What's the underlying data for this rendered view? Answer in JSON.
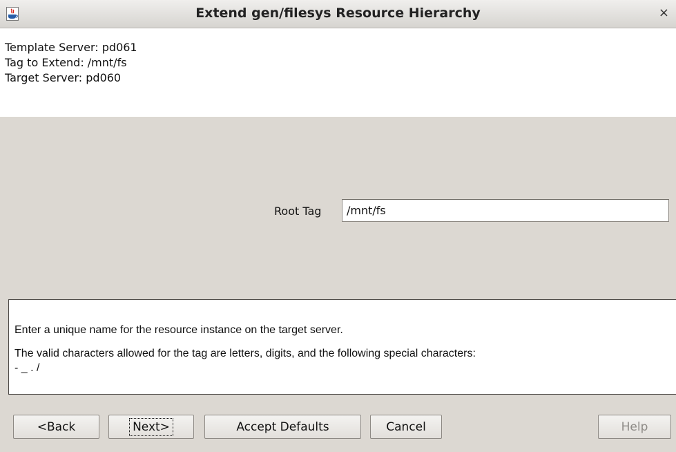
{
  "window": {
    "title": "Extend gen/filesys Resource Hierarchy",
    "close_glyph": "×"
  },
  "info": {
    "template_server": "Template Server: pd061",
    "tag_to_extend": "Tag to Extend: /mnt/fs",
    "target_server": "Target Server: pd060"
  },
  "form": {
    "root_tag_label": "Root Tag",
    "root_tag_value": "/mnt/fs"
  },
  "help": {
    "line1": "Enter a unique name for the resource instance on the target server.",
    "line2": "The valid characters allowed for the tag are letters, digits, and the following special characters:",
    "line3": "- _ . /"
  },
  "buttons": {
    "back": "<Back",
    "next": "Next>",
    "accept_defaults": "Accept Defaults",
    "cancel": "Cancel",
    "help": "Help"
  },
  "colors": {
    "dialog_bg": "#dcd8d2",
    "panel_bg": "#ffffff",
    "disabled_text": "#8d8a86"
  }
}
